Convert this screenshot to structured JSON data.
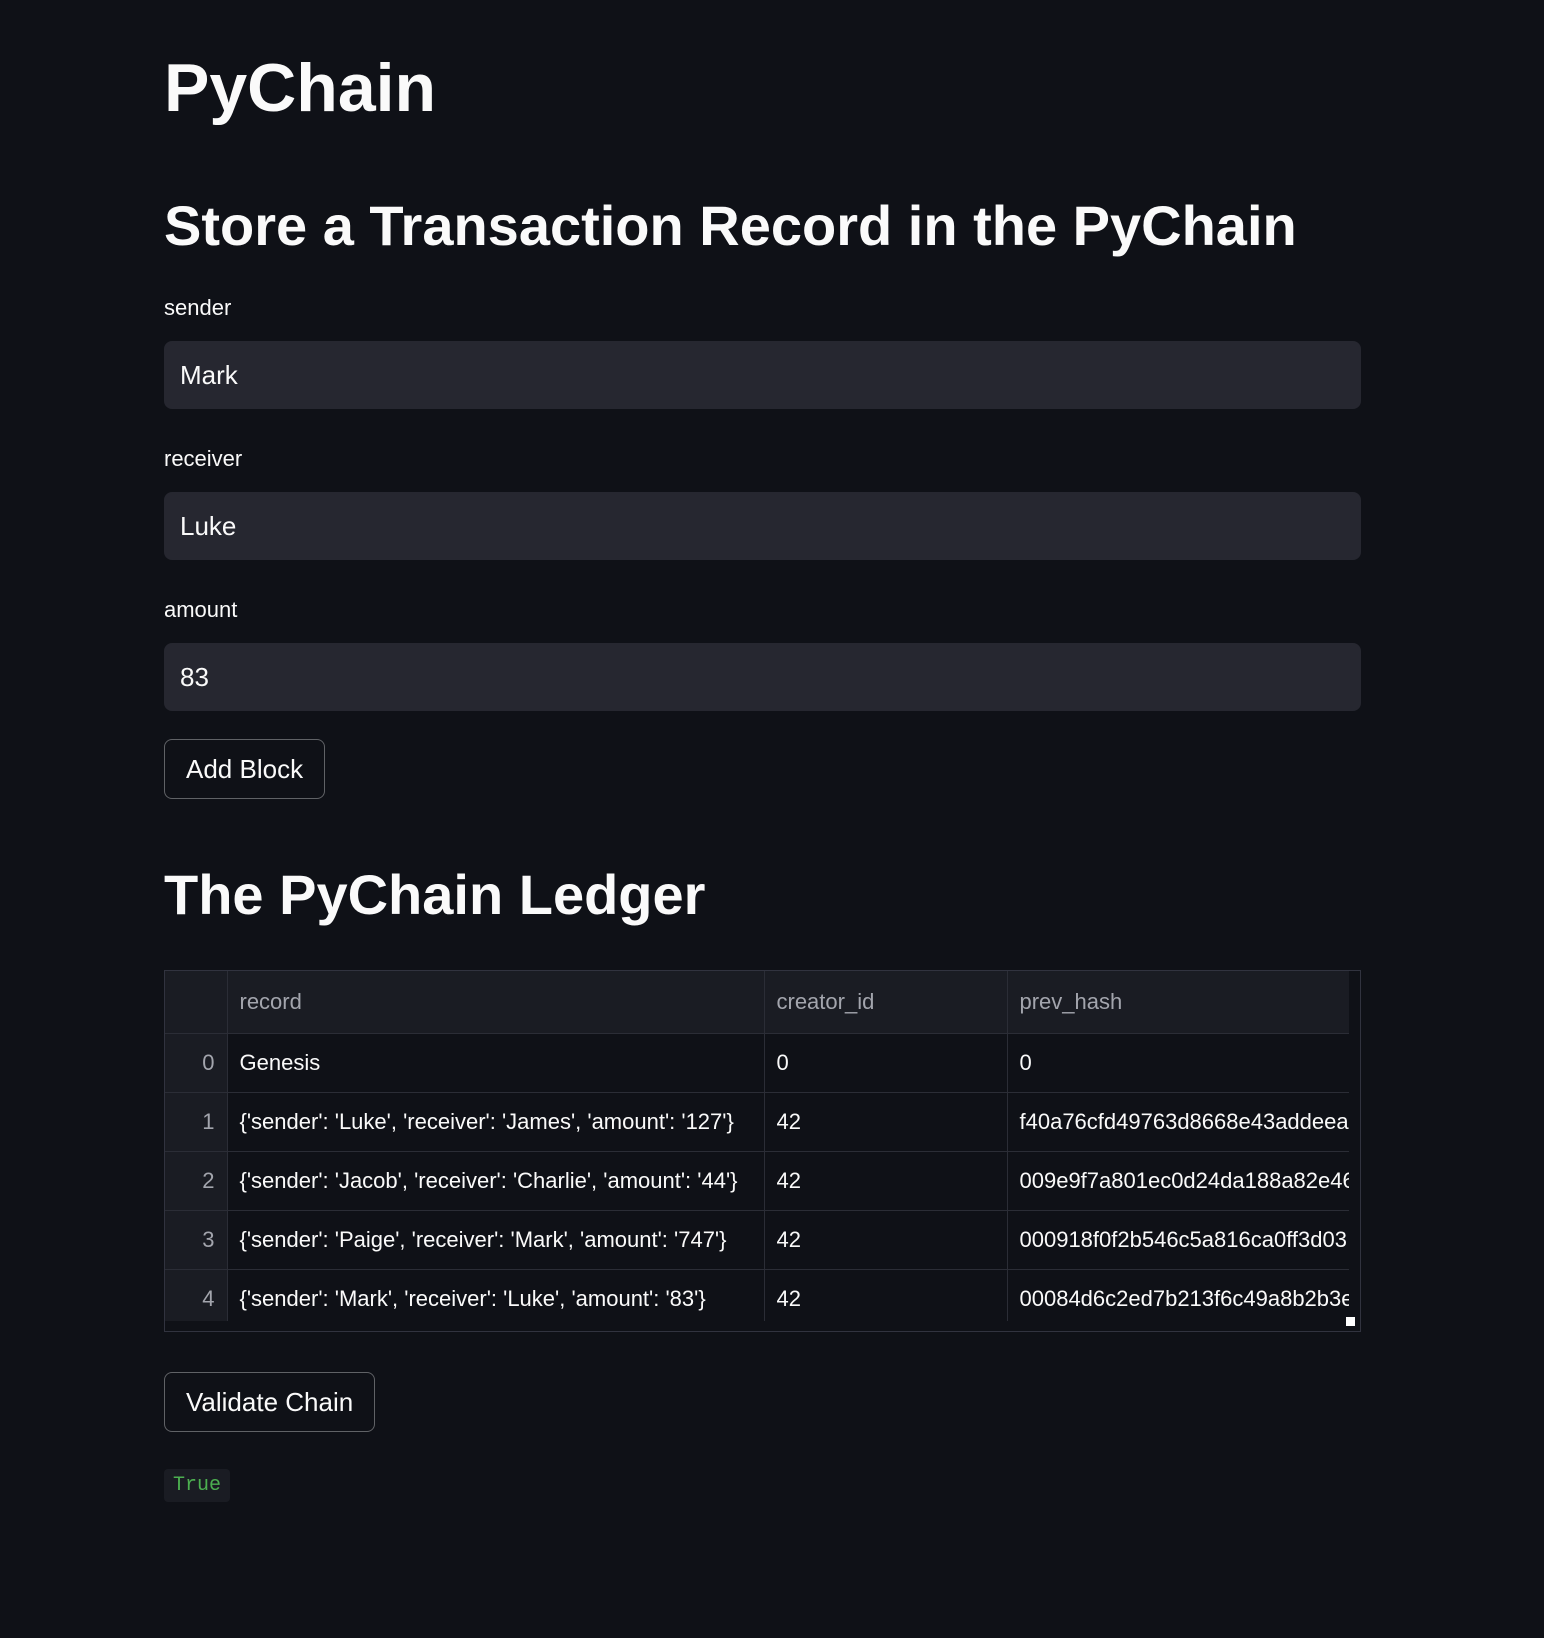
{
  "app": {
    "title": "PyChain"
  },
  "form": {
    "heading": "Store a Transaction Record in the PyChain",
    "sender": {
      "label": "sender",
      "value": "Mark"
    },
    "receiver": {
      "label": "receiver",
      "value": "Luke"
    },
    "amount": {
      "label": "amount",
      "value": "83"
    },
    "add_button_label": "Add Block"
  },
  "ledger": {
    "heading": "The PyChain Ledger",
    "columns": [
      "",
      "record",
      "creator_id",
      "prev_hash"
    ],
    "rows": [
      {
        "index": "0",
        "record": "Genesis",
        "creator_id": "0",
        "prev_hash": "0"
      },
      {
        "index": "1",
        "record": "{'sender': 'Luke', 'receiver': 'James', 'amount': '127'}",
        "creator_id": "42",
        "prev_hash": "f40a76cfd49763d8668e43addeea"
      },
      {
        "index": "2",
        "record": "{'sender': 'Jacob', 'receiver': 'Charlie', 'amount': '44'}",
        "creator_id": "42",
        "prev_hash": "009e9f7a801ec0d24da188a82e46"
      },
      {
        "index": "3",
        "record": "{'sender': 'Paige', 'receiver': 'Mark', 'amount': '747'}",
        "creator_id": "42",
        "prev_hash": "000918f0f2b546c5a816ca0ff3d03"
      },
      {
        "index": "4",
        "record": "{'sender': 'Mark', 'receiver': 'Luke', 'amount': '83'}",
        "creator_id": "42",
        "prev_hash": "00084d6c2ed7b213f6c49a8b2b3e"
      }
    ]
  },
  "validate": {
    "button_label": "Validate Chain",
    "result": "True",
    "result_color": "#4caf50"
  },
  "colors": {
    "background": "#0f1117",
    "input_background": "#262730",
    "text": "#fafafa"
  }
}
